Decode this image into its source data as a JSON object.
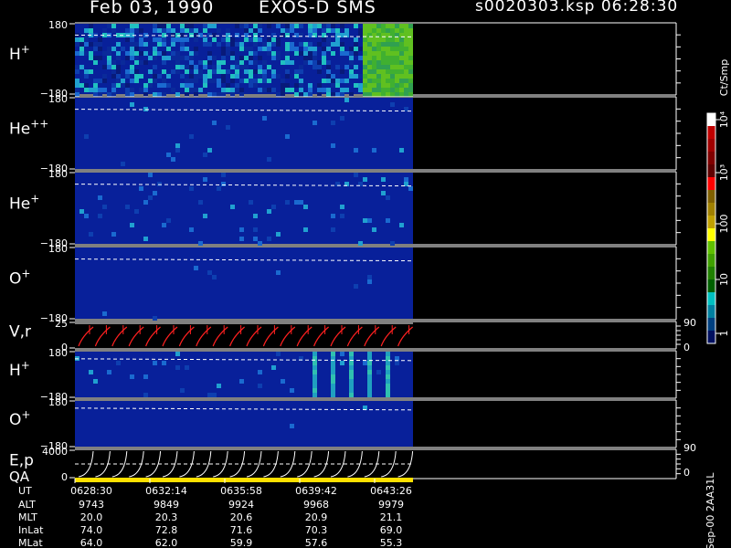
{
  "header": {
    "date": "Feb 03, 1990",
    "instrument": "EXOS-D SMS",
    "file_time": "s0020303.ksp  06:28:30"
  },
  "panels": [
    {
      "label": "H",
      "sup": "+",
      "ymax": "180",
      "ymin": "−180",
      "kind": "spec",
      "seed": 11,
      "level": 0.55,
      "highlight": true
    },
    {
      "label": "He",
      "sup": "++",
      "ymax": "180",
      "ymin": "−180",
      "kind": "spec",
      "seed": 23,
      "level": 0.02
    },
    {
      "label": "He",
      "sup": "+",
      "ymax": "180",
      "ymin": "−180",
      "kind": "spec",
      "seed": 37,
      "level": 0.05
    },
    {
      "label": "O",
      "sup": "+",
      "ymax": "180",
      "ymin": "−180",
      "kind": "spec",
      "seed": 41,
      "level": 0.01
    },
    {
      "label": "V,r",
      "sup": "",
      "ymax": "25",
      "ymin": "0",
      "kind": "vr",
      "right_top": "90",
      "right_bottom": "0"
    },
    {
      "label": "H",
      "sup": "+",
      "ymax": "180",
      "ymin": "−180",
      "kind": "spec",
      "seed": 53,
      "level": 0.04,
      "bursts": true
    },
    {
      "label": "O",
      "sup": "+",
      "ymax": "180",
      "ymin": "−180",
      "kind": "spec",
      "seed": 67,
      "level": 0.005
    },
    {
      "label": "E,p",
      "sup": "",
      "label2": "QA",
      "ymax": "4000",
      "ymin": "0",
      "kind": "ep",
      "right_top": "90",
      "right_bottom": "0"
    }
  ],
  "colorbar": {
    "units": "Ct/Smp",
    "ticks": [
      "10⁴",
      "10³",
      "100",
      "10",
      "1"
    ],
    "colors": [
      "#ffffff",
      "#c00000",
      "#a00000",
      "#800000",
      "#600000",
      "#ff0000",
      "#806000",
      "#a08000",
      "#c0a000",
      "#ffff00",
      "#60c000",
      "#40a000",
      "#208000",
      "#006000",
      "#00c0c0",
      "#0080a0",
      "#004080",
      "#001060"
    ]
  },
  "footer_rows": [
    {
      "name": "UT",
      "values": [
        "0628:30",
        "0632:14",
        "0635:58",
        "0639:42",
        "0643:26"
      ]
    },
    {
      "name": "ALT",
      "values": [
        "9743",
        "9849",
        "9924",
        "9968",
        "9979"
      ]
    },
    {
      "name": "MLT",
      "values": [
        "20.0",
        "20.3",
        "20.6",
        "20.9",
        "21.1"
      ]
    },
    {
      "name": "InLat",
      "values": [
        "74.0",
        "72.8",
        "71.6",
        "70.3",
        "69.0"
      ]
    },
    {
      "name": "MLat",
      "values": [
        "64.0",
        "62.0",
        "59.9",
        "57.6",
        "55.3"
      ]
    }
  ],
  "side_note": "Sep-00 2AA31L",
  "chart_data": {
    "type": "heatmap",
    "title": "Feb 03, 1990   EXOS-D SMS",
    "x_label": "UT",
    "x_ticks": [
      "0628:30",
      "0632:14",
      "0635:58",
      "0639:42",
      "0643:26"
    ],
    "species": [
      "H+",
      "He++",
      "He+",
      "O+",
      "V,r",
      "H+",
      "O+",
      "E,p QA"
    ],
    "y_range_pitch": [
      -180,
      180
    ],
    "vr_range": [
      0,
      25
    ],
    "ep_range": [
      0,
      4000
    ],
    "colorbar_range": [
      "1",
      "10⁴"
    ],
    "colorbar_units": "Ct/Smp"
  }
}
